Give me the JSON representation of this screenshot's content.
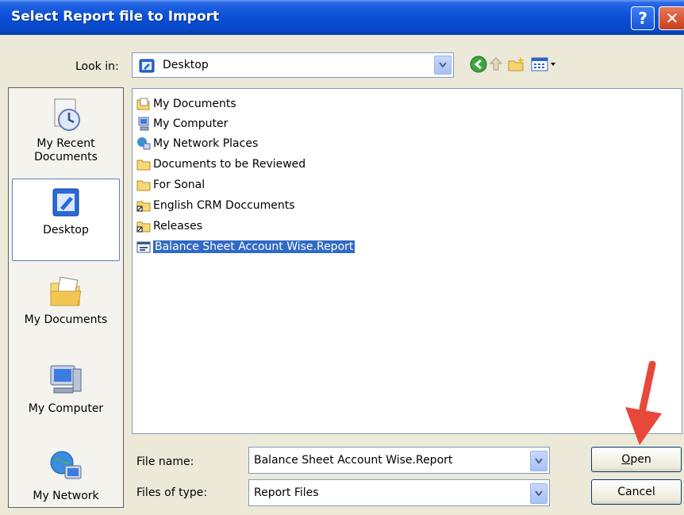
{
  "dialog": {
    "title": "Select Report file to Import",
    "help_label": "?",
    "close_label": "✕"
  },
  "lookin": {
    "label": "Look in:",
    "value": "Desktop"
  },
  "places": [
    {
      "name": "recent",
      "label_line1": "My Recent",
      "label_line2": "Documents"
    },
    {
      "name": "desktop",
      "label_line1": "Desktop",
      "label_line2": ""
    },
    {
      "name": "documents",
      "label_line1": "My Documents",
      "label_line2": ""
    },
    {
      "name": "computer",
      "label_line1": "My Computer",
      "label_line2": ""
    },
    {
      "name": "network",
      "label_line1": "My Network",
      "label_line2": ""
    }
  ],
  "files": [
    {
      "label": "My Documents",
      "icon": "my-documents-icon"
    },
    {
      "label": "My Computer",
      "icon": "my-computer-icon"
    },
    {
      "label": "My Network Places",
      "icon": "network-places-icon"
    },
    {
      "label": "Documents to be Reviewed",
      "icon": "folder-icon"
    },
    {
      "label": "For Sonal",
      "icon": "folder-icon"
    },
    {
      "label": "English CRM Doccuments",
      "icon": "folder-shortcut-icon"
    },
    {
      "label": "Releases",
      "icon": "folder-shortcut-icon"
    },
    {
      "label": "Balance  Sheet Account Wise.Report",
      "icon": "report-file-icon",
      "selected": true
    }
  ],
  "filename": {
    "label": "File name:",
    "value": "Balance  Sheet Account Wise.Report"
  },
  "filetype": {
    "label": "Files of type:",
    "value": "Report Files"
  },
  "buttons": {
    "open_first": "O",
    "open_rest": "pen",
    "cancel": "Cancel"
  },
  "colors": {
    "titlebar": "#0a4fd6",
    "selection": "#316ac5",
    "annotation_arrow": "#e8483a"
  }
}
